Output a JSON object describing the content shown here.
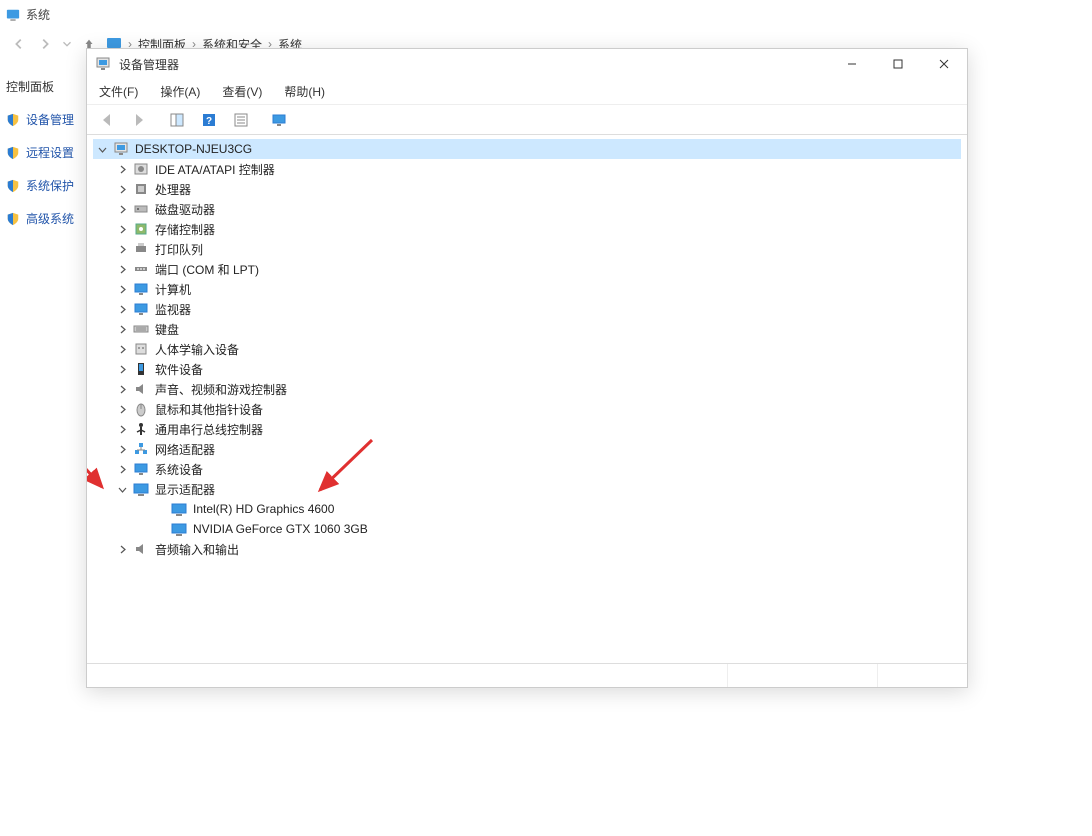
{
  "bg": {
    "title": "系统",
    "crumbs": [
      "控制面板",
      "系统和安全",
      "系统"
    ],
    "sidebar_header": "控制面板",
    "sidebar_items": [
      "设备管理",
      "远程设置",
      "系统保护",
      "高级系统"
    ]
  },
  "dm": {
    "title": "设备管理器",
    "menu": {
      "file": "文件(F)",
      "action": "操作(A)",
      "view": "查看(V)",
      "help": "帮助(H)"
    },
    "root": "DESKTOP-NJEU3CG",
    "categories": [
      {
        "name": "IDE ATA/ATAPI 控制器",
        "icon": "ide"
      },
      {
        "name": "处理器",
        "icon": "cpu"
      },
      {
        "name": "磁盘驱动器",
        "icon": "disk"
      },
      {
        "name": "存储控制器",
        "icon": "storage"
      },
      {
        "name": "打印队列",
        "icon": "printer"
      },
      {
        "name": "端口 (COM 和 LPT)",
        "icon": "port"
      },
      {
        "name": "计算机",
        "icon": "monitor"
      },
      {
        "name": "监视器",
        "icon": "monitor"
      },
      {
        "name": "键盘",
        "icon": "keyboard"
      },
      {
        "name": "人体学输入设备",
        "icon": "hid"
      },
      {
        "name": "软件设备",
        "icon": "software"
      },
      {
        "name": "声音、视频和游戏控制器",
        "icon": "sound"
      },
      {
        "name": "鼠标和其他指针设备",
        "icon": "mouse"
      },
      {
        "name": "通用串行总线控制器",
        "icon": "usb"
      },
      {
        "name": "网络适配器",
        "icon": "network"
      },
      {
        "name": "系统设备",
        "icon": "system"
      }
    ],
    "display_adapter_label": "显示适配器",
    "display_adapters": [
      "Intel(R) HD Graphics 4600",
      "NVIDIA GeForce GTX 1060 3GB"
    ],
    "audio_label": "音频输入和输出"
  }
}
